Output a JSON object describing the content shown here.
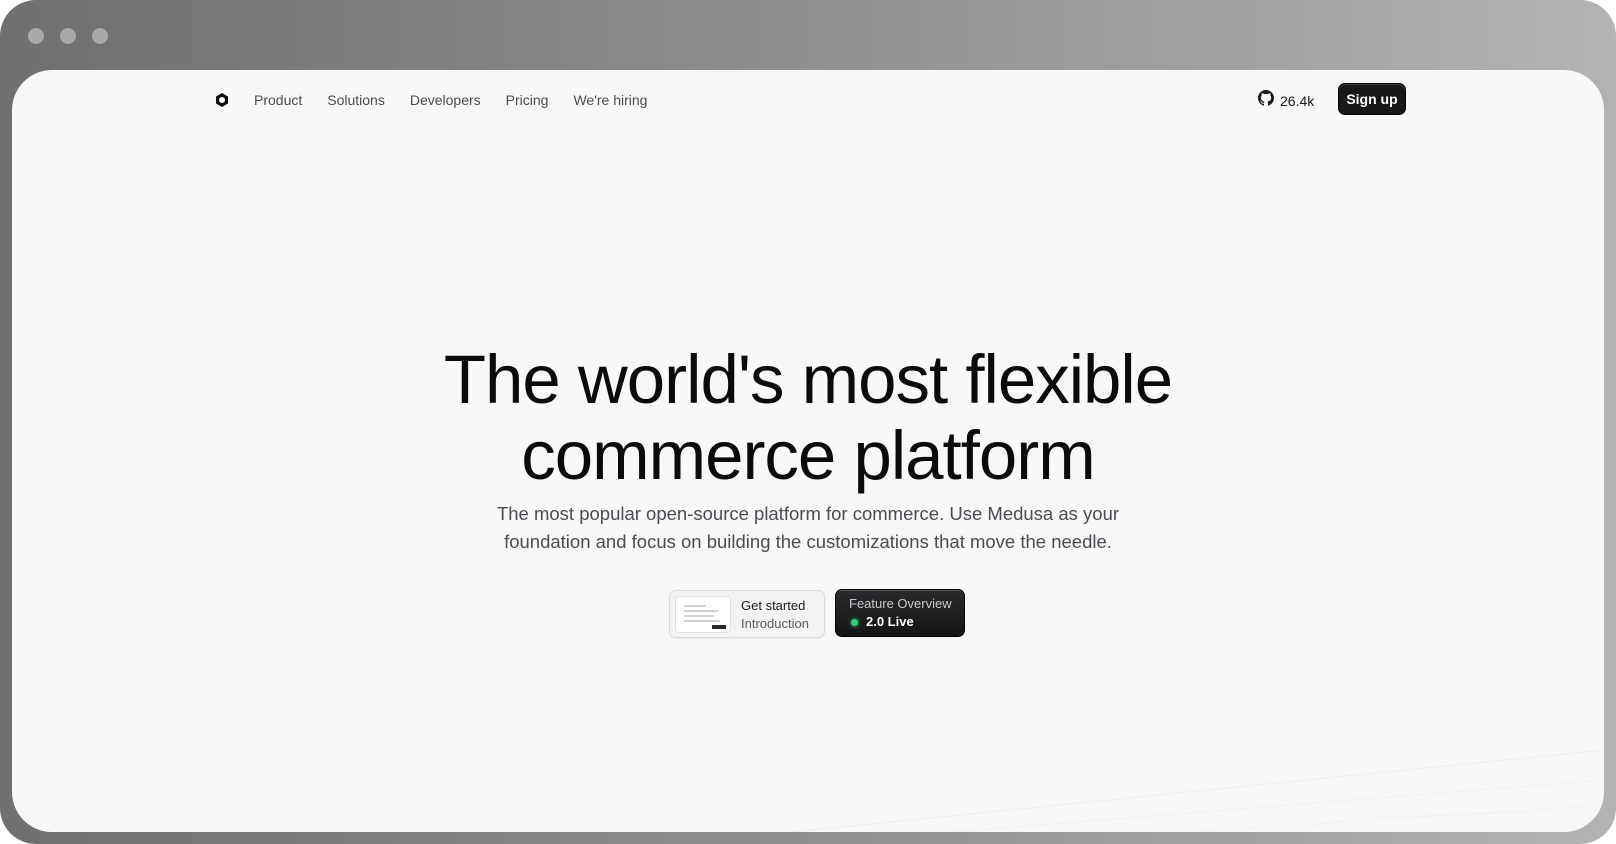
{
  "nav": {
    "logo_icon": "medusa-logo-icon",
    "links": [
      "Product",
      "Solutions",
      "Developers",
      "Pricing",
      "We're hiring"
    ],
    "github_stars": "26.4k",
    "github_icon": "github-icon",
    "signup_label": "Sign up"
  },
  "hero": {
    "title_line1": "The world's most flexible",
    "title_line2": "commerce platform",
    "subtitle_line1": "The most popular open-source platform for commerce. Use Medusa as your",
    "subtitle_line2": "foundation and focus on building the customizations that move the needle."
  },
  "cta": {
    "get_started_title": "Get started",
    "get_started_sub": "Introduction",
    "feature_title": "Feature Overview",
    "feature_sub": "2.0 Live",
    "live_color": "#2ad17a"
  },
  "colors": {
    "background": "#f8f8f8",
    "button_dark": "#18181b",
    "text_primary": "#0b0b0c"
  }
}
